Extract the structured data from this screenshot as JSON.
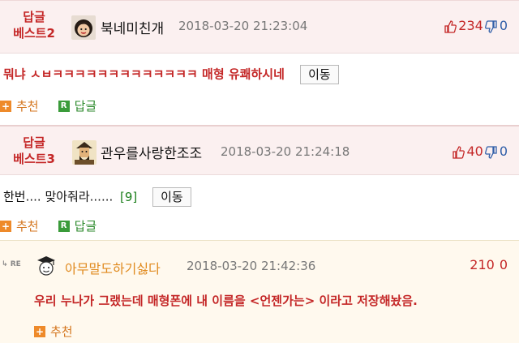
{
  "comments": [
    {
      "badge_line1": "답글",
      "badge_line2": "베스트2",
      "nickname": "북네미친개",
      "date": "2018-03-20 21:23:04",
      "upvotes": "234",
      "downvotes": "0",
      "body": "뭐냐 ㅅㅂㅋㅋㅋㅋㅋㅋㅋㅋㅋㅋㅋㅋㅋ 매형 유쾌하시네",
      "move_label": "이동",
      "recommend_label": "추천",
      "reply_label": "답글"
    },
    {
      "badge_line1": "답글",
      "badge_line2": "베스트3",
      "nickname": "관우를사랑한조조",
      "date": "2018-03-20 21:24:18",
      "upvotes": "40",
      "downvotes": "0",
      "body": "한번.... 맞아줘라......",
      "reply_count": "[9]",
      "move_label": "이동",
      "recommend_label": "추천",
      "reply_label": "답글"
    },
    {
      "re_label": "RE",
      "nickname": "아무말도하기싫다",
      "date": "2018-03-20 21:42:36",
      "upvotes": "210",
      "downvotes": "0",
      "body": "우리 누나가 그랬는데 매형폰에 내 이름을 <언젠가는> 이라고 저장해놨음.",
      "recommend_label": "추천"
    }
  ],
  "icons": {
    "thumbs_up": "thumbs-up-icon",
    "thumbs_down": "thumbs-down-icon",
    "plus": "plus-icon",
    "reply": "reply-r-icon"
  },
  "colors": {
    "accent_red": "#c42727",
    "best_header_bg": "#fbf0f0",
    "reply_bg": "#fff9ee",
    "orange": "#ee8a2a",
    "green": "#3a9b3a",
    "downvote_blue": "#2f5ea8"
  }
}
